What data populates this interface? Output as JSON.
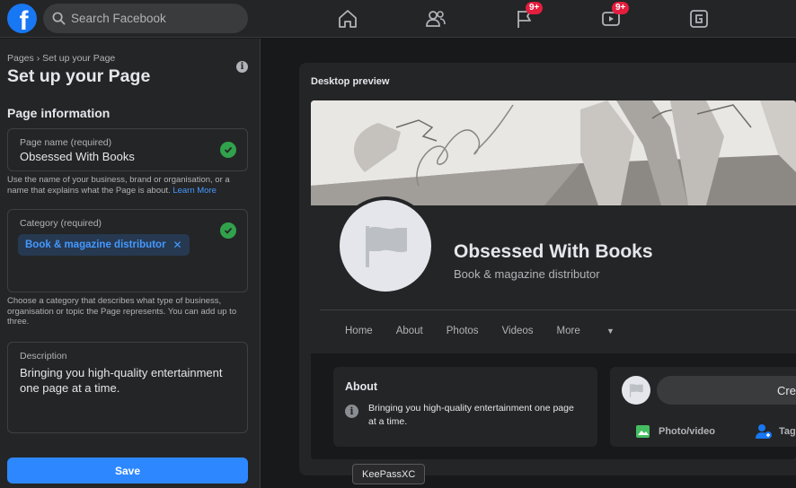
{
  "header": {
    "search": {
      "placeholder": "Search Facebook"
    },
    "badges": {
      "flag": "9+",
      "watch": "9+"
    }
  },
  "left": {
    "breadcrumb": "Pages › Set up your Page",
    "title": "Set up your Page",
    "section": "Page information",
    "page_name": {
      "label": "Page name (required)",
      "value": "Obsessed With Books",
      "help": "Use the name of your business, brand or organisation, or a name that explains what the Page is about.",
      "help_link": "Learn More"
    },
    "category": {
      "label": "Category (required)",
      "chip": "Book & magazine distributor",
      "help": "Choose a category that describes what type of business, organisation or topic the Page represents. You can add up to three."
    },
    "description": {
      "label": "Description",
      "value": "Bringing you high-quality entertainment one page at a time."
    },
    "save_label": "Save"
  },
  "preview": {
    "label": "Desktop preview",
    "page_name": "Obsessed With Books",
    "category": "Book & magazine distributor",
    "tabs": [
      "Home",
      "About",
      "Photos",
      "Videos",
      "More"
    ],
    "about_title": "About",
    "about_text": "Bringing you high-quality entertainment one page at a time.",
    "create_text": "Cre",
    "action_photo": "Photo/video",
    "action_tag": "Tag"
  },
  "tooltip": "KeePassXC",
  "colors": {
    "accent": "#2d88ff",
    "check": "#31a24c",
    "badge": "#e41e3f"
  }
}
